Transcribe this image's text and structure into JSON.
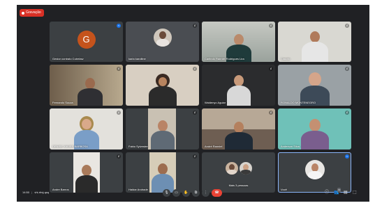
{
  "recording": {
    "label": "Gravação"
  },
  "tiles": [
    {
      "name": "Gestor contrato Cutrelaw",
      "initial": "G",
      "mic": "≈",
      "mic_active": true
    },
    {
      "name": "karla karolline",
      "mic": "♯"
    },
    {
      "name": "Carlindo Ranniel Rodrigues Lira",
      "mic": "♯"
    },
    {
      "name": "Cláudio",
      "mic": "♯"
    },
    {
      "name": "Fernando Souza",
      "mic": "♯"
    },
    {
      "name": "",
      "mic": "♯"
    },
    {
      "name": "Waldenyo Aguiar",
      "mic": "♯"
    },
    {
      "name": "RONALDO MONTENEGRO",
      "mic": "♯"
    },
    {
      "name": "DENISE XAVIER BARBOSA",
      "mic": "♯"
    },
    {
      "name": "Fabio Sylvestre",
      "mic": "♯"
    },
    {
      "name": "André Ranniel",
      "mic": "♯"
    },
    {
      "name": "Anderson Silva",
      "mic": "♯"
    },
    {
      "name": "Andre Barros",
      "mic": "♯"
    },
    {
      "name": "Haldar Andrade",
      "mic": "♯"
    },
    {
      "name": "Mais 3 pessoas",
      "mic": ""
    },
    {
      "name": "Você",
      "mic": "≈",
      "mic_active": true
    }
  ],
  "bottom": {
    "time": "14:50",
    "meeting_code": "vhi-rfmj-qsq",
    "separator": "|",
    "participants_count": "19"
  },
  "colors": {
    "meet_bg": "#202124",
    "tile_bg": "#3c4043",
    "end_call": "#ea4335",
    "active": "#1a73e8"
  },
  "icons": [
    "mic-icon",
    "camera-icon",
    "raise-hand-icon",
    "present-icon",
    "more-options-icon",
    "end-call-icon",
    "info-icon",
    "people-icon",
    "chat-icon",
    "activities-icon"
  ]
}
